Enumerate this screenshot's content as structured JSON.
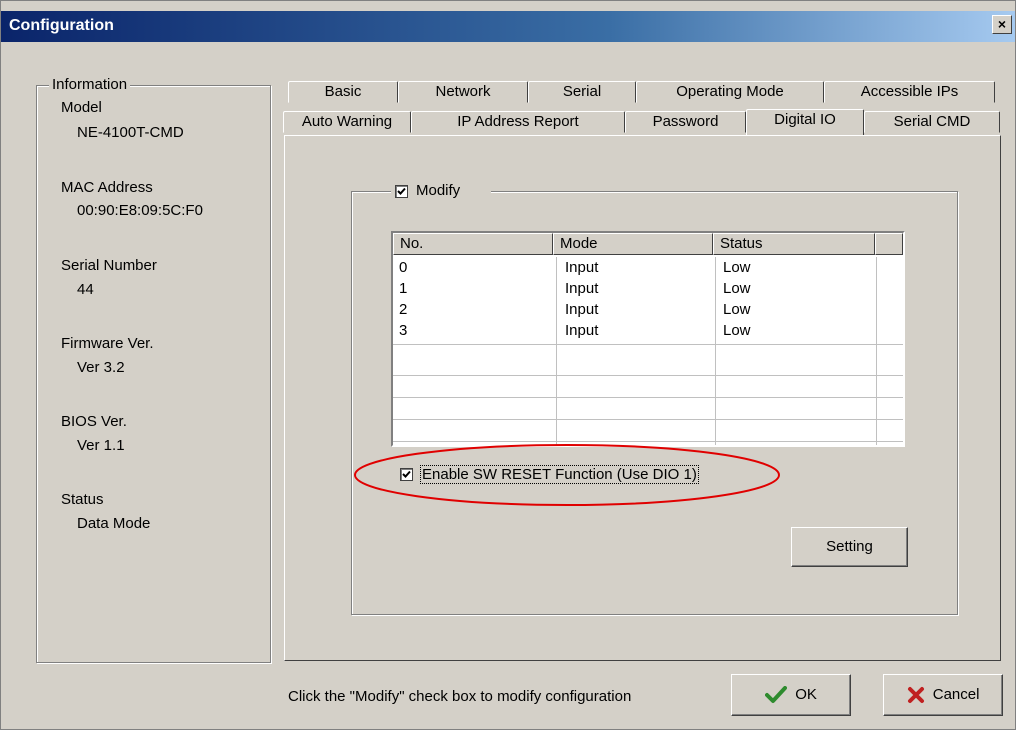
{
  "window": {
    "title": "Configuration",
    "close_glyph": "×"
  },
  "info": {
    "legend": "Information",
    "model_label": "Model",
    "model_value": "NE-4100T-CMD",
    "mac_label": "MAC Address",
    "mac_value": "00:90:E8:09:5C:F0",
    "serial_label": "Serial Number",
    "serial_value": "44",
    "firmware_label": "Firmware Ver.",
    "firmware_value": "Ver 3.2",
    "bios_label": "BIOS Ver.",
    "bios_value": "Ver 1.1",
    "status_label": "Status",
    "status_value": "Data Mode"
  },
  "tabs": {
    "row1": [
      "Basic",
      "Network",
      "Serial",
      "Operating Mode",
      "Accessible IPs"
    ],
    "row2": [
      "Auto Warning",
      "IP Address Report",
      "Password",
      "Digital IO",
      "Serial CMD"
    ],
    "active": "Digital IO"
  },
  "digital_io": {
    "modify_label": "Modify",
    "modify_checked": true,
    "columns": [
      "No.",
      "Mode",
      "Status"
    ],
    "rows": [
      [
        "0",
        "Input",
        "Low"
      ],
      [
        "1",
        "Input",
        "Low"
      ],
      [
        "2",
        "Input",
        "Low"
      ],
      [
        "3",
        "Input",
        "Low"
      ]
    ],
    "sw_reset_label": "Enable SW RESET Function (Use DIO 1)",
    "sw_reset_checked": true,
    "setting_button": "Setting"
  },
  "footer": {
    "hint": "Click the \"Modify\" check box to modify configuration",
    "ok_label": "OK",
    "cancel_label": "Cancel"
  },
  "colors": {
    "titlebar_start": "#0a246a",
    "highlight_ellipse": "#e00000",
    "ok_icon": "#2e8b2e",
    "cancel_icon": "#c02020"
  }
}
